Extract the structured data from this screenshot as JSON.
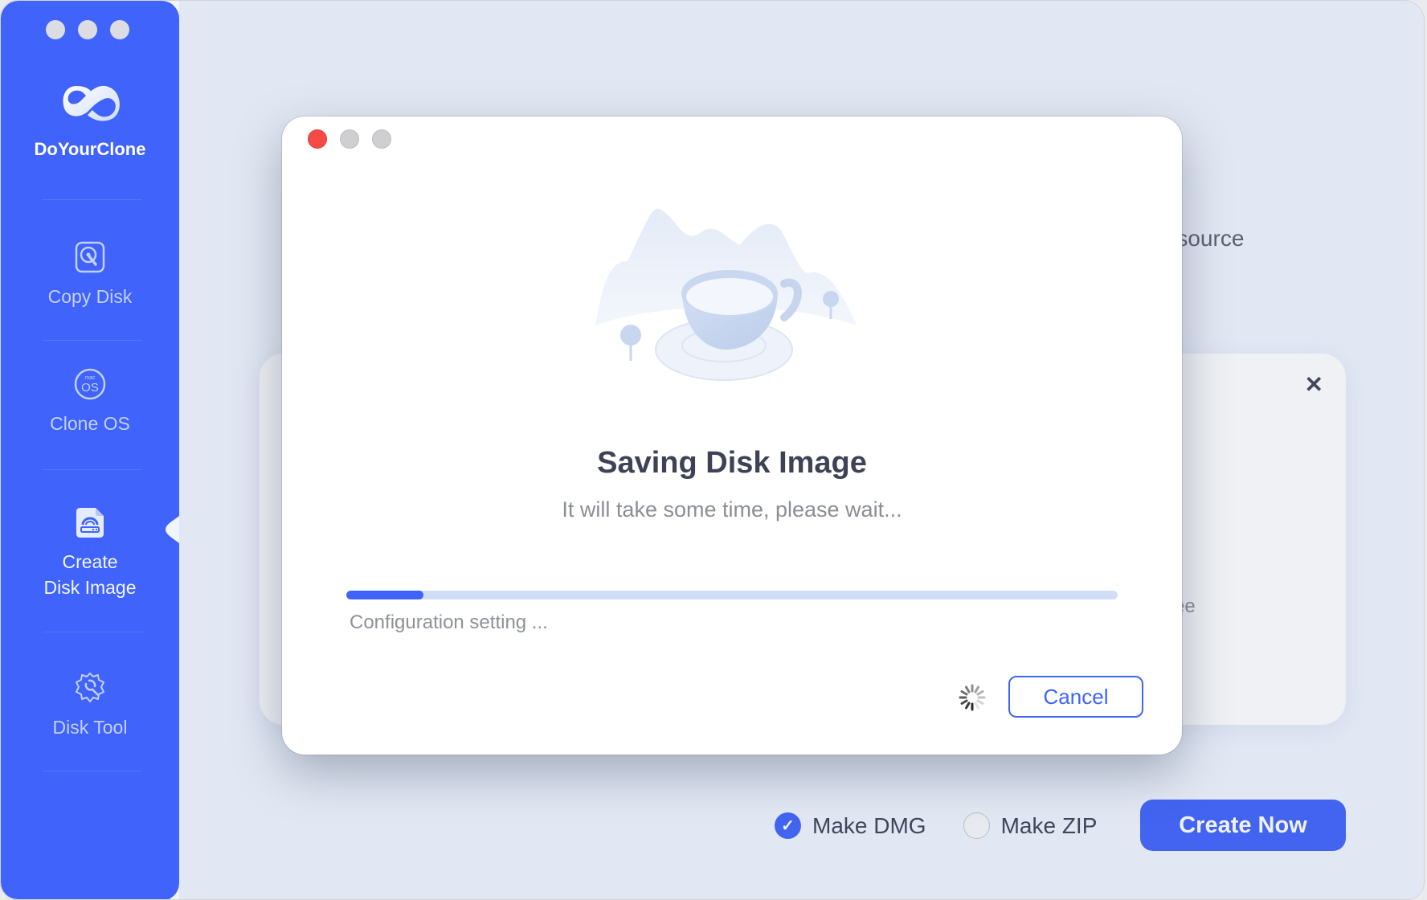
{
  "app": {
    "name": "DoYourClone",
    "logo_icon": "infinity-cloud-logo",
    "accent_color": "#3f63fb"
  },
  "sidebar": {
    "items": [
      {
        "label": "Copy Disk",
        "icon": "disk-icon",
        "active": false
      },
      {
        "label": "Clone OS",
        "icon": "macos-icon",
        "active": false
      },
      {
        "label_line1": "Create",
        "label_line2": "Disk Image",
        "icon": "disk-image-file-icon",
        "active": true
      },
      {
        "label": "Disk Tool",
        "icon": "gear-wrench-icon",
        "active": false
      }
    ]
  },
  "background": {
    "source_text": "e source",
    "free_text": "ee",
    "card_close_icon": "close-icon",
    "options": [
      {
        "label": "Make DMG",
        "checked": true
      },
      {
        "label": "Make ZIP",
        "checked": false
      }
    ],
    "create_button": "Create Now"
  },
  "dialog": {
    "title": "Saving Disk Image",
    "subtitle": "It will take some time, please wait...",
    "progress_percent": 10,
    "status": "Configuration setting ...",
    "cancel_button": "Cancel",
    "illustration": "teacup-mountains-illustration",
    "spinner_icon": "loading-spinner-icon"
  }
}
